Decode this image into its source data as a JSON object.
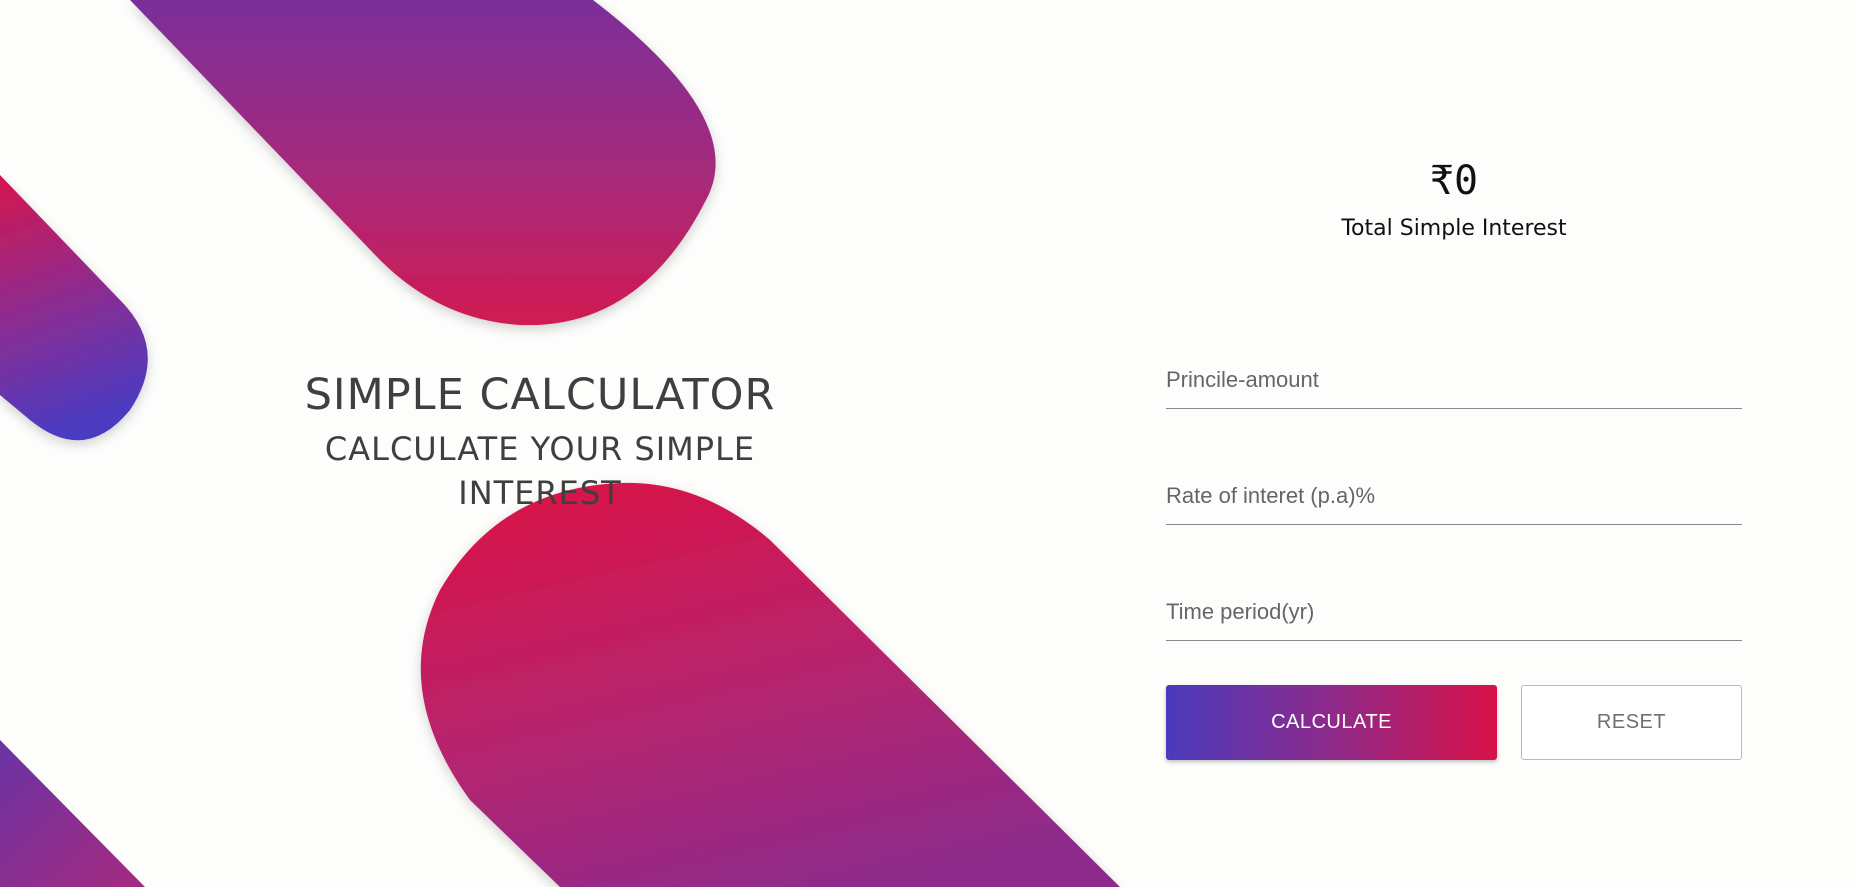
{
  "hero": {
    "title": "SIMPLE CALCULATOR",
    "subtitle": "CALCULATE YOUR SIMPLE INTEREST"
  },
  "result": {
    "amount": "₹0",
    "label": "Total Simple Interest"
  },
  "form": {
    "principal_placeholder": "Princile-amount",
    "rate_placeholder": "Rate of interet (p.a)%",
    "time_placeholder": "Time period(yr)",
    "principal_value": "",
    "rate_value": "",
    "time_value": ""
  },
  "buttons": {
    "calculate_label": "CALCULATE",
    "reset_label": "RESET"
  },
  "colors": {
    "gradient_blue": "#4a3bbd",
    "gradient_purple": "#8e2a8a",
    "gradient_pink": "#d81248",
    "text_dark": "#3f3f3f"
  }
}
